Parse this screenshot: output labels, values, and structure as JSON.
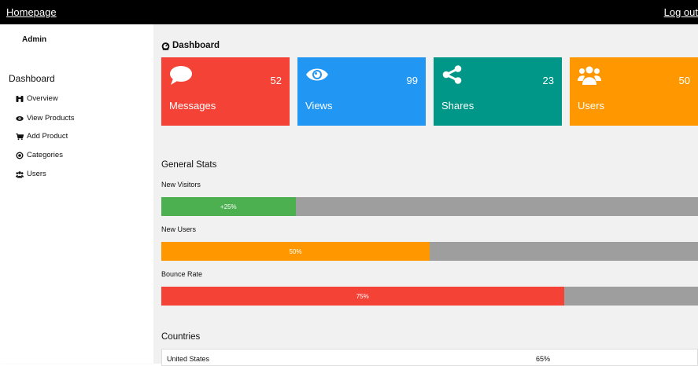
{
  "topbar": {
    "home_label": "Homepage",
    "logout_label": "Log out"
  },
  "sidebar": {
    "admin_label": "Admin",
    "heading": "Dashboard",
    "items": [
      {
        "label": "Overview",
        "icon": "binoculars-icon"
      },
      {
        "label": "View Products",
        "icon": "eye-icon"
      },
      {
        "label": "Add Product",
        "icon": "cart-icon"
      },
      {
        "label": "Categories",
        "icon": "bullseye-icon"
      },
      {
        "label": "Users",
        "icon": "users-icon"
      }
    ]
  },
  "main": {
    "title": "Dashboard",
    "title_icon": "dashboard-icon",
    "cards": [
      {
        "label": "Messages",
        "value": "52",
        "icon": "comment-icon",
        "color": "#f44336"
      },
      {
        "label": "Views",
        "value": "99",
        "icon": "eye-icon",
        "color": "#2196f3"
      },
      {
        "label": "Shares",
        "value": "23",
        "icon": "share-icon",
        "color": "#009688"
      },
      {
        "label": "Users",
        "value": "50",
        "icon": "users-icon",
        "color": "#ff9800"
      }
    ],
    "general_stats": {
      "title": "General Stats",
      "stats": [
        {
          "label": "New Visitors",
          "value_text": "+25%",
          "percent": 25,
          "color": "#4caf50"
        },
        {
          "label": "New Users",
          "value_text": "50%",
          "percent": 50,
          "color": "#ff9800"
        },
        {
          "label": "Bounce Rate",
          "value_text": "75%",
          "percent": 75,
          "color": "#f44336"
        }
      ]
    },
    "countries": {
      "title": "Countries",
      "rows": [
        {
          "country": "United States",
          "value": "65%"
        }
      ]
    }
  }
}
